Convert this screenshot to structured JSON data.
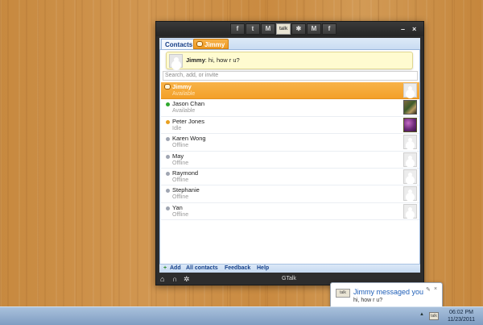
{
  "window": {
    "toolbar_icons": [
      {
        "name": "facebook-icon",
        "glyph": "f"
      },
      {
        "name": "twitter-icon",
        "glyph": "t"
      },
      {
        "name": "gmail-icon",
        "glyph": "M"
      },
      {
        "name": "gtalk-icon",
        "glyph": "talk"
      },
      {
        "name": "delicious-icon",
        "glyph": "✱"
      },
      {
        "name": "gmail-icon",
        "glyph": "M"
      },
      {
        "name": "facebook-icon",
        "glyph": "f"
      }
    ],
    "minimize_glyph": "–",
    "close_glyph": "×",
    "tabs": {
      "contacts_label": "Contacts",
      "chat_label": "Jimmy"
    },
    "notification": {
      "sender": "Jimmy",
      "message": ": hi, how r u?"
    },
    "search": {
      "placeholder": "Search, add, or invite"
    },
    "contacts": [
      {
        "name": "Jimmy",
        "status": "Available",
        "dot": "chat",
        "avatar": "default",
        "selected": true
      },
      {
        "name": "Jason Chan",
        "status": "Available",
        "dot": "#2fa82f",
        "avatar": "pic-jason",
        "selected": false
      },
      {
        "name": "Peter Jones",
        "status": "Idle",
        "dot": "#e8a020",
        "avatar": "pic-peter",
        "selected": false
      },
      {
        "name": "Karen Wong",
        "status": "Offline",
        "dot": "#a0a6b2",
        "avatar": "default",
        "selected": false
      },
      {
        "name": "May",
        "status": "Offline",
        "dot": "#a0a6b2",
        "avatar": "default",
        "selected": false
      },
      {
        "name": "Raymond",
        "status": "Offline",
        "dot": "#a0a6b2",
        "avatar": "default",
        "selected": false
      },
      {
        "name": "Stephanie",
        "status": "Offline",
        "dot": "#a0a6b2",
        "avatar": "default",
        "selected": false
      },
      {
        "name": "Yan",
        "status": "Offline",
        "dot": "#a0a6b2",
        "avatar": "default",
        "selected": false
      }
    ],
    "bottom_links": {
      "add_plus": "+",
      "add": "Add",
      "all_contacts": "All contacts",
      "feedback": "Feedback",
      "help": "Help"
    },
    "statusbar": {
      "home_glyph": "⌂",
      "headset_glyph": "∩",
      "settings_glyph": "✲",
      "title": "GTalk"
    }
  },
  "toast": {
    "icon_text": "talk",
    "title": "Jimmy messaged you",
    "message": "hi, how r u?",
    "pin_glyph": "✎",
    "close_glyph": "×"
  },
  "taskbar": {
    "tray_arrow": "▲",
    "tray_icon_text": "talk",
    "time": "06:02 PM",
    "date": "11/23/2011"
  },
  "colors": {
    "selected_row": "#f3a028",
    "link_blue": "#15408a",
    "toast_title": "#1f5fb8"
  }
}
